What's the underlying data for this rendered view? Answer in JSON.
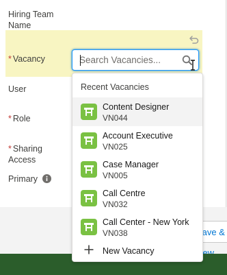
{
  "form": {
    "hiring_team_name_label": "Hiring Team\nName",
    "vacancy_label": "Vacancy",
    "user_label": "User",
    "role_label": "Role",
    "sharing_access_label": "Sharing\nAccess",
    "primary_label": "Primary",
    "required_marker": "*"
  },
  "search": {
    "placeholder": "Search Vacancies...",
    "value": ""
  },
  "dropdown": {
    "header": "Recent Vacancies",
    "items": [
      {
        "name": "Content Designer",
        "code": "VN044"
      },
      {
        "name": "Account Executive",
        "code": "VN025"
      },
      {
        "name": "Case Manager",
        "code": "VN005"
      },
      {
        "name": "Call Centre",
        "code": "VN032"
      },
      {
        "name": "Call Center - New York",
        "code": "VN038"
      }
    ],
    "new_label": "New Vacancy"
  },
  "footer": {
    "save_new_label": "Save & New"
  },
  "colors": {
    "highlight": "#f8f5c2",
    "focus_border": "#1b96ff",
    "vacancy_icon": "#7ac143",
    "footer": "#2b5d2b",
    "required": "#c23934"
  },
  "icons": {
    "undo": "undo-icon",
    "search": "search-icon",
    "vacancy": "vacancy-icon",
    "add": "plus-icon",
    "info": "info-icon"
  }
}
